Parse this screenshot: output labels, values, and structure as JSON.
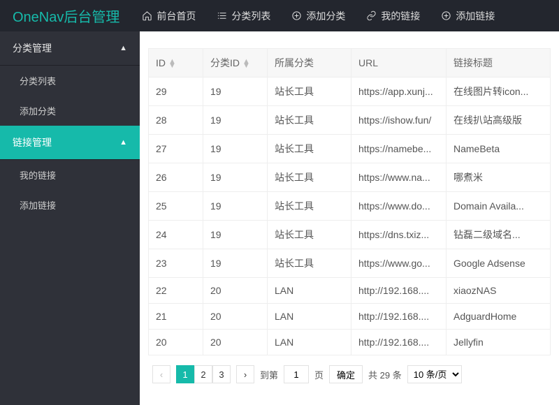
{
  "header": {
    "brand": "OneNav后台管理",
    "items": [
      {
        "icon": "home",
        "label": "前台首页"
      },
      {
        "icon": "list",
        "label": "分类列表"
      },
      {
        "icon": "plus-circle",
        "label": "添加分类"
      },
      {
        "icon": "link",
        "label": "我的链接"
      },
      {
        "icon": "plus-circle",
        "label": "添加链接"
      }
    ]
  },
  "sidebar": {
    "groups": [
      {
        "label": "分类管理",
        "active": false,
        "children": [
          {
            "label": "分类列表"
          },
          {
            "label": "添加分类"
          }
        ]
      },
      {
        "label": "链接管理",
        "active": true,
        "children": [
          {
            "label": "我的链接"
          },
          {
            "label": "添加链接"
          }
        ]
      }
    ]
  },
  "table": {
    "headers": {
      "id": "ID",
      "cat_id": "分类ID",
      "cat": "所属分类",
      "url": "URL",
      "title": "链接标题"
    },
    "rows": [
      {
        "id": "29",
        "cat_id": "19",
        "cat": "站长工具",
        "url": "https://app.xunj...",
        "title": "在线图片转icon..."
      },
      {
        "id": "28",
        "cat_id": "19",
        "cat": "站长工具",
        "url": "https://ishow.fun/",
        "title": "在线扒站高级版"
      },
      {
        "id": "27",
        "cat_id": "19",
        "cat": "站长工具",
        "url": "https://namebe...",
        "title": "NameBeta"
      },
      {
        "id": "26",
        "cat_id": "19",
        "cat": "站长工具",
        "url": "https://www.na...",
        "title": "哪煮米"
      },
      {
        "id": "25",
        "cat_id": "19",
        "cat": "站长工具",
        "url": "https://www.do...",
        "title": "Domain Availa..."
      },
      {
        "id": "24",
        "cat_id": "19",
        "cat": "站长工具",
        "url": "https://dns.txiz...",
        "title": "钻磊二级域名..."
      },
      {
        "id": "23",
        "cat_id": "19",
        "cat": "站长工具",
        "url": "https://www.go...",
        "title": "Google Adsense"
      },
      {
        "id": "22",
        "cat_id": "20",
        "cat": "LAN",
        "url": "http://192.168....",
        "title": "xiaozNAS"
      },
      {
        "id": "21",
        "cat_id": "20",
        "cat": "LAN",
        "url": "http://192.168....",
        "title": "AdguardHome"
      },
      {
        "id": "20",
        "cat_id": "20",
        "cat": "LAN",
        "url": "http://192.168....",
        "title": "Jellyfin"
      }
    ]
  },
  "pager": {
    "pages": [
      "1",
      "2",
      "3"
    ],
    "current": "1",
    "goto_label_pre": "到第",
    "goto_value": "1",
    "goto_label_post": "页",
    "confirm": "确定",
    "total": "共 29 条",
    "per_page": "10 条/页"
  }
}
